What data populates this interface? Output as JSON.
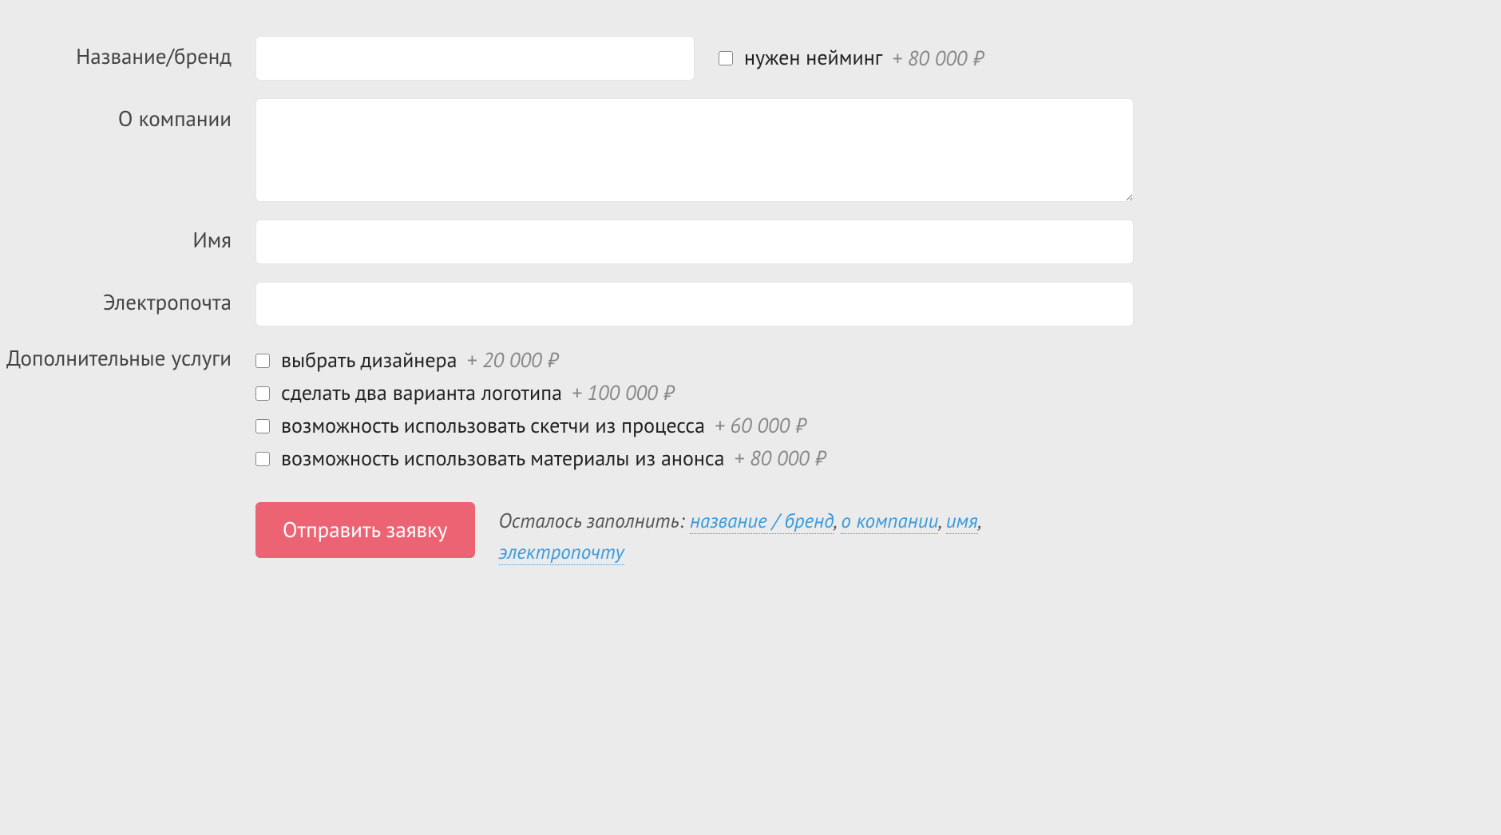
{
  "form": {
    "brand": {
      "label": "Название/бренд",
      "value": "",
      "naming_checkbox_label": "нужен нейминг",
      "naming_price": "+ 80 000 ₽"
    },
    "about": {
      "label": "О компании",
      "value": ""
    },
    "name": {
      "label": "Имя",
      "value": ""
    },
    "email": {
      "label": "Электропочта",
      "value": ""
    },
    "services": {
      "label": "Дополнительные услуги",
      "items": [
        {
          "label": "выбрать дизайнера",
          "price": "+ 20 000 ₽"
        },
        {
          "label": "сделать два варианта логотипа",
          "price": "+ 100 000 ₽"
        },
        {
          "label": "возможность использовать скетчи из процесса",
          "price": "+ 60 000 ₽"
        },
        {
          "label": "возможность использовать материалы из анонса",
          "price": "+ 80 000 ₽"
        }
      ]
    },
    "submit_label": "Отправить заявку",
    "remaining": {
      "prefix": "Осталось заполнить: ",
      "links": [
        "название / бренд",
        "о компании",
        "имя",
        "электропочту"
      ]
    }
  }
}
